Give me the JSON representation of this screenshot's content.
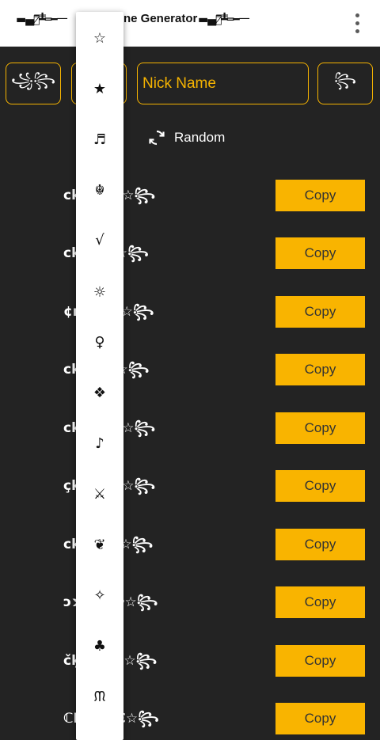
{
  "appbar": {
    "title": "ne Generator",
    "deco_left": "▬▄︻̷̿┻̿═━一",
    "deco_right": "▬▄︻̷̿┻̿═━一"
  },
  "toolbar": {
    "left_deco_1": "꧁꧂",
    "left_deco_2": "꧁",
    "input_value": "Nick Name",
    "right_deco": "꧂"
  },
  "random": {
    "label": "Random"
  },
  "results": [
    {
      "name": "ckNamε☆꧂",
      "copy": "Copy"
    },
    {
      "name": "ckηძσε☆꧂",
      "copy": "Copy"
    },
    {
      "name": "¢кηαмē☆꧂",
      "copy": "Copy"
    },
    {
      "name": "cknმოε☆꧂",
      "copy": "Copy"
    },
    {
      "name": "ckNāmε☆꧂",
      "copy": "Copy"
    },
    {
      "name": "çkname☆꧂",
      "copy": "Copy"
    },
    {
      "name": "ckИлмε☆꧂",
      "copy": "Copy"
    },
    {
      "name": "ɔʞNemɐ☆꧂",
      "copy": "Copy"
    },
    {
      "name": "čķŇämë☆꧂",
      "copy": "Copy"
    },
    {
      "name": "ℂҚЛΛπЄ☆꧂",
      "copy": "Copy"
    }
  ],
  "symbol_menu": [
    "☆",
    "★",
    "♬",
    "☬",
    "√",
    "☼",
    "♀",
    "❖",
    "♪",
    "⚔",
    "❦",
    "✧",
    "♣",
    "ᙏ"
  ]
}
